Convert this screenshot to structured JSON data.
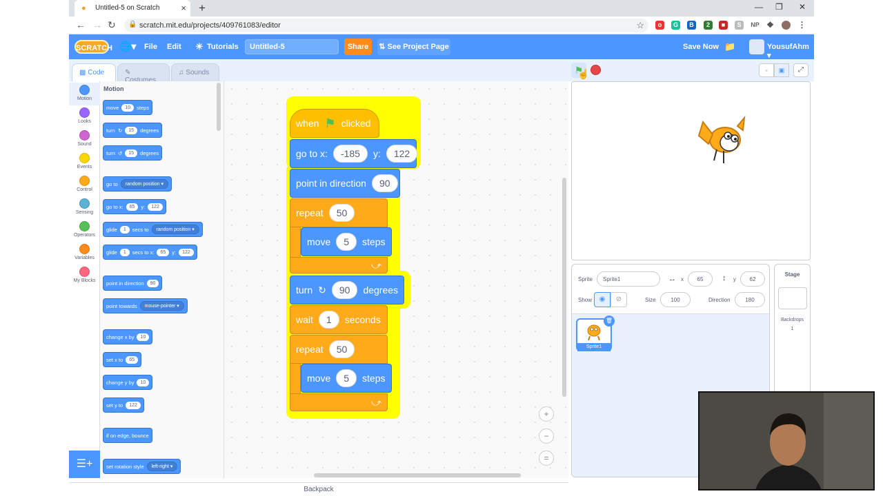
{
  "browser": {
    "tab_title": "Untitled-5 on Scratch",
    "url": "scratch.mit.edu/projects/409761083/editor"
  },
  "menubar": {
    "logo": "SCRATCH",
    "file": "File",
    "edit": "Edit",
    "tutorials": "Tutorials",
    "project_title": "Untitled-5",
    "share": "Share",
    "see_project_page": "See Project Page",
    "save_now": "Save Now",
    "username": "YousufAhm"
  },
  "editor_tabs": {
    "code": "Code",
    "costumes": "Costumes",
    "sounds": "Sounds"
  },
  "categories": [
    {
      "label": "Motion",
      "color": "#4c97ff"
    },
    {
      "label": "Looks",
      "color": "#9966ff"
    },
    {
      "label": "Sound",
      "color": "#cf63cf"
    },
    {
      "label": "Events",
      "color": "#ffd500"
    },
    {
      "label": "Control",
      "color": "#ffab19"
    },
    {
      "label": "Sensing",
      "color": "#5cb1d6"
    },
    {
      "label": "Operators",
      "color": "#59c059"
    },
    {
      "label": "Variables",
      "color": "#ff8c1a"
    },
    {
      "label": "My Blocks",
      "color": "#ff6680"
    }
  ],
  "palette": {
    "title": "Motion",
    "move": {
      "a": "move",
      "v": "10",
      "b": "steps"
    },
    "turn_right": {
      "a": "turn",
      "v": "15",
      "b": "degrees"
    },
    "turn_left": {
      "a": "turn",
      "v": "15",
      "b": "degrees"
    },
    "go_to": {
      "a": "go to",
      "dd": "random position"
    },
    "go_to_xy": {
      "a": "go to x:",
      "x": "65",
      "b": "y:",
      "y": "122"
    },
    "glide_to": {
      "a": "glide",
      "v": "1",
      "b": "secs to",
      "dd": "random position"
    },
    "glide_xy": {
      "a": "glide",
      "v": "1",
      "b": "secs to x:",
      "x": "65",
      "c": "y:",
      "y": "122"
    },
    "point_dir": {
      "a": "point in direction",
      "v": "90"
    },
    "point_towards": {
      "a": "point towards",
      "dd": "mouse-pointer"
    },
    "change_x": {
      "a": "change x by",
      "v": "10"
    },
    "set_x": {
      "a": "set x to",
      "v": "65"
    },
    "change_y": {
      "a": "change y by",
      "v": "10"
    },
    "set_y": {
      "a": "set y to",
      "v": "122"
    },
    "bounce": {
      "a": "if on edge, bounce"
    },
    "rotation": {
      "a": "set rotation style",
      "dd": "left-right"
    }
  },
  "script": {
    "hat": {
      "a": "when",
      "b": "clicked"
    },
    "goto": {
      "a": "go to x:",
      "x": "-185",
      "b": "y:",
      "y": "122"
    },
    "point": {
      "a": "point in direction",
      "v": "90"
    },
    "repeat1": {
      "a": "repeat",
      "v": "50"
    },
    "move1": {
      "a": "move",
      "v": "5",
      "b": "steps"
    },
    "turn": {
      "a": "turn",
      "v": "90",
      "b": "degrees"
    },
    "wait": {
      "a": "wait",
      "v": "1",
      "b": "seconds"
    },
    "repeat2": {
      "a": "repeat",
      "v": "50"
    },
    "move2": {
      "a": "move",
      "v": "5",
      "b": "steps"
    }
  },
  "backpack": "Backpack",
  "sprite_info": {
    "sprite_label": "Sprite",
    "sprite_name": "Sprite1",
    "x_label": "x",
    "x": "65",
    "y_label": "y",
    "y": "62",
    "show_label": "Show",
    "size_label": "Size",
    "size": "100",
    "direction_label": "Direction",
    "direction": "180"
  },
  "sprite_tile": "Sprite1",
  "stage_panel": {
    "title": "Stage",
    "backdrops_label": "Backdrops",
    "backdrops_count": "1"
  },
  "colors": {
    "motion": "#4c97ff",
    "control": "#ffab19",
    "events": "#ffbf00",
    "menubar": "#4c97ff",
    "share": "#ff8c1a"
  }
}
